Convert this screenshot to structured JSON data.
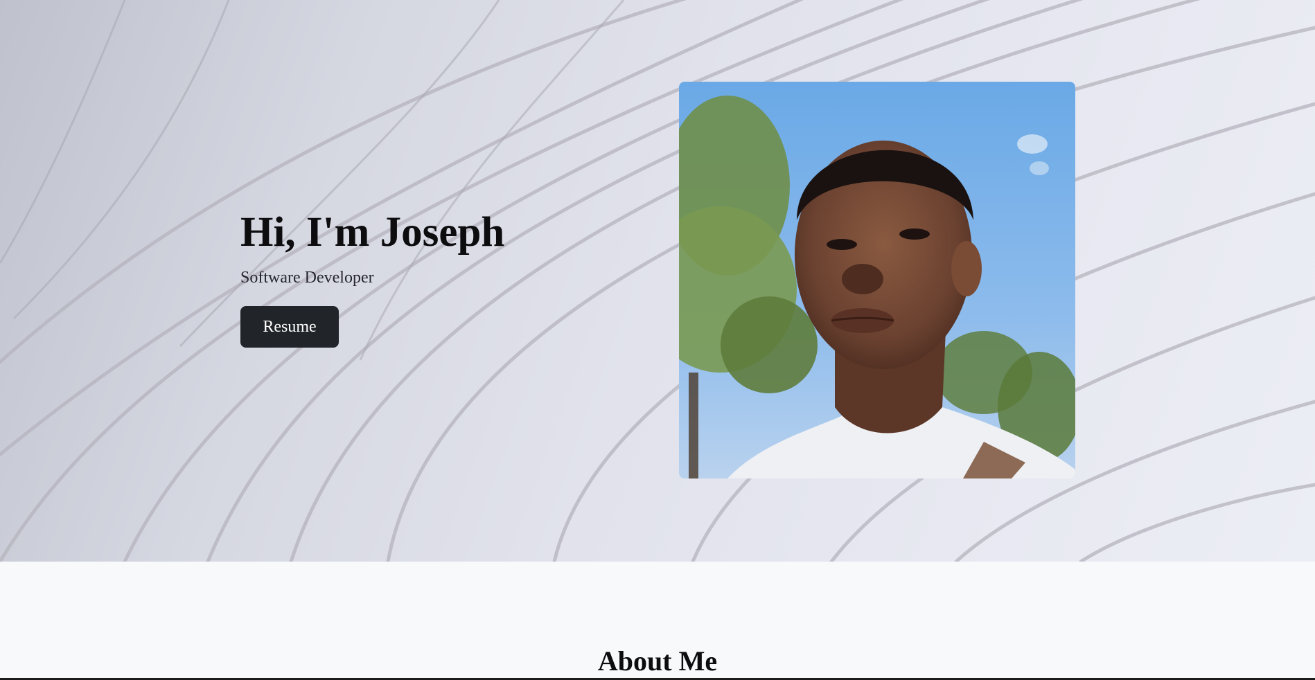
{
  "hero": {
    "title": "Hi, I'm Joseph",
    "subtitle": "Software Developer",
    "resume_label": "Resume",
    "photo_alt": "Portrait of Joseph"
  },
  "about": {
    "title": "About Me"
  },
  "colors": {
    "button_bg": "#212428",
    "button_text": "#ffffff",
    "page_bg": "#f8f9fb",
    "hero_bg": "#e1e2ec"
  }
}
